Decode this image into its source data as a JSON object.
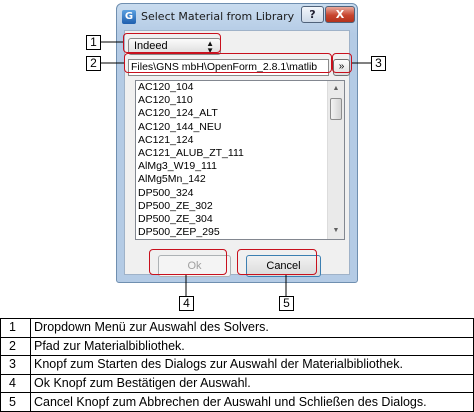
{
  "dialog": {
    "title": "Select Material from Library",
    "help_label": "?",
    "close_label": "X",
    "app_icon_glyph": "G",
    "solver_value": "Indeed",
    "path_value": "Files\\GNS mbH\\OpenForm_2.8.1\\matlib",
    "browse_label": "»",
    "materials": [
      "AC120_104",
      "AC120_110",
      "AC120_124_ALT",
      "AC120_144_NEU",
      "AC121_124",
      "AC121_ALUB_ZT_111",
      "AlMg3_W19_111",
      "AlMg5Mn_142",
      "DP500_324",
      "DP500_ZE_302",
      "DP500_ZE_304",
      "DP500_ZEP_295"
    ],
    "ok_label": "Ok",
    "ok_enabled": false,
    "cancel_label": "Cancel"
  },
  "callouts": [
    "1",
    "2",
    "3",
    "4",
    "5"
  ],
  "legend": [
    {
      "num": "1",
      "text": "Dropdown Menü zur Auswahl des Solvers."
    },
    {
      "num": "2",
      "text": "Pfad zur Materialbibliothek."
    },
    {
      "num": "3",
      "text": "Knopf zum Starten des Dialogs zur Auswahl der Materialbibliothek."
    },
    {
      "num": "4",
      "text": "Ok Knopf zum Bestätigen der Auswahl."
    },
    {
      "num": "5",
      "text": "Cancel Knopf zum Abbrechen der Auswahl und Schließen des Dialogs."
    }
  ],
  "colors": {
    "highlight": "#c8101d",
    "window_frame": "#b4cbe5",
    "close_button": "#c8452e"
  }
}
